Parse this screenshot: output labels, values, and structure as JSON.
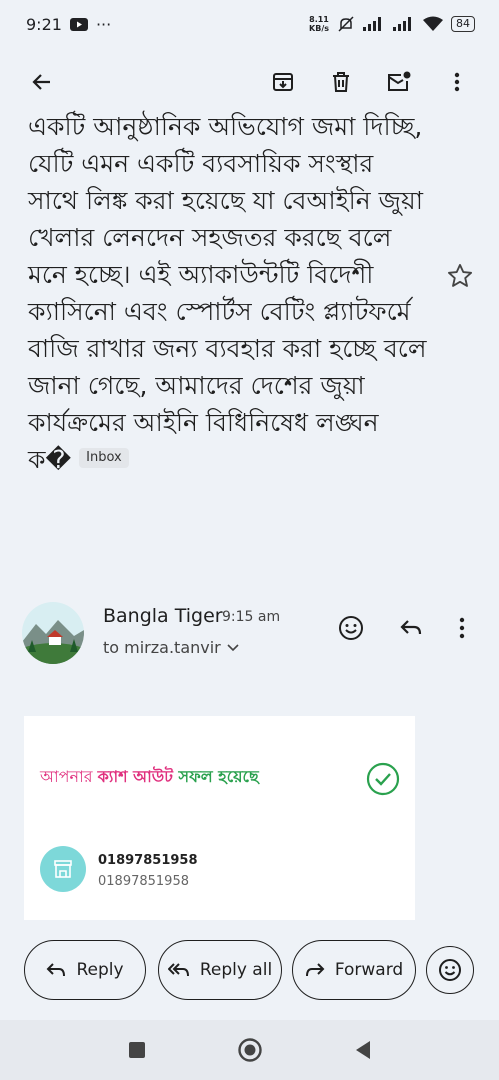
{
  "status_bar": {
    "time": "9:21",
    "speed_value": "8.11",
    "speed_unit": "KB/s",
    "battery": "84"
  },
  "app_bar": {
    "icons": [
      "back-arrow-icon",
      "archive-icon",
      "delete-icon",
      "mark-unread-icon",
      "more-vert-icon"
    ]
  },
  "email": {
    "body": "একটি আনুষ্ঠানিক অভিযোগ জমা দিচ্ছি, যেটি এমন একটি ব্যবসায়িক সংস্থার সাথে লিঙ্ক করা হয়েছে যা বেআইনি জুয়া খেলার লেনদেন সহজতর করছে বলে মনে হচ্ছে। এই অ্যাকাউন্টটি বিদেশী ক্যাসিনো এবং স্পোর্টস বেটিং প্ল্যাটফর্মে বাজি রাখার জন্য ব্যবহার করা হচ্ছে বলে জানা গেছে, আমাদের দেশের জুয়া কার্যক্রমের আইনি বিধিনিষেধ লঙ্ঘন ক�",
    "label_chip": "Inbox"
  },
  "message": {
    "sender": "Bangla Tiger",
    "time": "9:15 am",
    "to": "to mirza.tanvir"
  },
  "card": {
    "part1": "আপনার ",
    "part2": "ক্যাশ আউট ",
    "part3": "সফল হয়েছে",
    "phone_primary": "01897851958",
    "phone_secondary": "01897851958"
  },
  "actions": {
    "reply": "Reply",
    "reply_all": "Reply all",
    "forward": "Forward"
  },
  "colors": {
    "accent_pink": "#e0307e",
    "accent_green": "#2aa14e"
  }
}
